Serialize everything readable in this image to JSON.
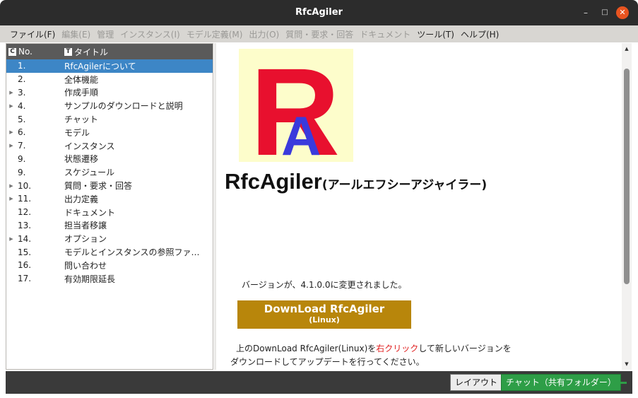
{
  "window": {
    "title": "RfcAgiler"
  },
  "menu": [
    {
      "label": "ファイル(F)",
      "enabled": true
    },
    {
      "label": "編集(E)",
      "enabled": false
    },
    {
      "label": "管理",
      "enabled": false
    },
    {
      "label": "インスタンス(I)",
      "enabled": false
    },
    {
      "label": "モデル定義(M)",
      "enabled": false
    },
    {
      "label": "出力(O)",
      "enabled": false
    },
    {
      "label": "質問・要求・回答",
      "enabled": false
    },
    {
      "label": "ドキュメント",
      "enabled": false
    },
    {
      "label": "ツール(T)",
      "enabled": true
    },
    {
      "label": "ヘルプ(H)",
      "enabled": true
    }
  ],
  "tree": {
    "columns": {
      "no": "No.",
      "title": "タイトル",
      "no_icon": "C",
      "title_icon": "T"
    },
    "rows": [
      {
        "no": "1.",
        "title": "RfcAgilerについて",
        "expandable": false,
        "selected": true
      },
      {
        "no": "2.",
        "title": "全体機能",
        "expandable": false,
        "selected": false
      },
      {
        "no": "3.",
        "title": "作成手順",
        "expandable": true,
        "selected": false
      },
      {
        "no": "4.",
        "title": "サンプルのダウンロードと説明",
        "expandable": true,
        "selected": false
      },
      {
        "no": "5.",
        "title": "チャット",
        "expandable": false,
        "selected": false
      },
      {
        "no": "6.",
        "title": "モデル",
        "expandable": true,
        "selected": false
      },
      {
        "no": "7.",
        "title": "インスタンス",
        "expandable": true,
        "selected": false
      },
      {
        "no": "9.",
        "title": "状態遷移",
        "expandable": false,
        "selected": false
      },
      {
        "no": "9.",
        "title": "スケジュール",
        "expandable": false,
        "selected": false
      },
      {
        "no": "10.",
        "title": "質問・要求・回答",
        "expandable": true,
        "selected": false
      },
      {
        "no": "11.",
        "title": "出力定義",
        "expandable": true,
        "selected": false
      },
      {
        "no": "12.",
        "title": "ドキュメント",
        "expandable": false,
        "selected": false
      },
      {
        "no": "13.",
        "title": "担当者移譲",
        "expandable": false,
        "selected": false
      },
      {
        "no": "14.",
        "title": "オプション",
        "expandable": true,
        "selected": false
      },
      {
        "no": "15.",
        "title": "モデルとインスタンスの参照ファ…",
        "expandable": false,
        "selected": false
      },
      {
        "no": "16.",
        "title": "問い合わせ",
        "expandable": false,
        "selected": false
      },
      {
        "no": "17.",
        "title": "有効期限延長",
        "expandable": false,
        "selected": false
      }
    ]
  },
  "content": {
    "logo_letters": {
      "main": "R",
      "sub": "A"
    },
    "app_name": "RfcAgiler",
    "app_reading": "(アールエフシーアジャイラー)",
    "version_text": "バージョンが、4.1.0.0に変更されました。",
    "download_button": {
      "line1": "DownLoad RfcAgiler",
      "line2": "(Linux)"
    },
    "info": {
      "part1": "上のDownLoad RfcAgiler(Linux)を",
      "highlight": "右クリック",
      "part2": "して新しいバージョンを",
      "line2": "ダウンロードしてアップデートを行ってください。"
    }
  },
  "bottom": {
    "layout_button": "レイアウト",
    "chat_button": "チャット（共有フォルダー）"
  },
  "colors": {
    "selected_row": "#3d86c6",
    "logo_red": "#e8102e",
    "logo_blue": "#3a3adc",
    "download_bg": "#b8860b",
    "chat_green": "#2e9e47",
    "highlight_red": "#e02020",
    "close_orange": "#e95420"
  }
}
